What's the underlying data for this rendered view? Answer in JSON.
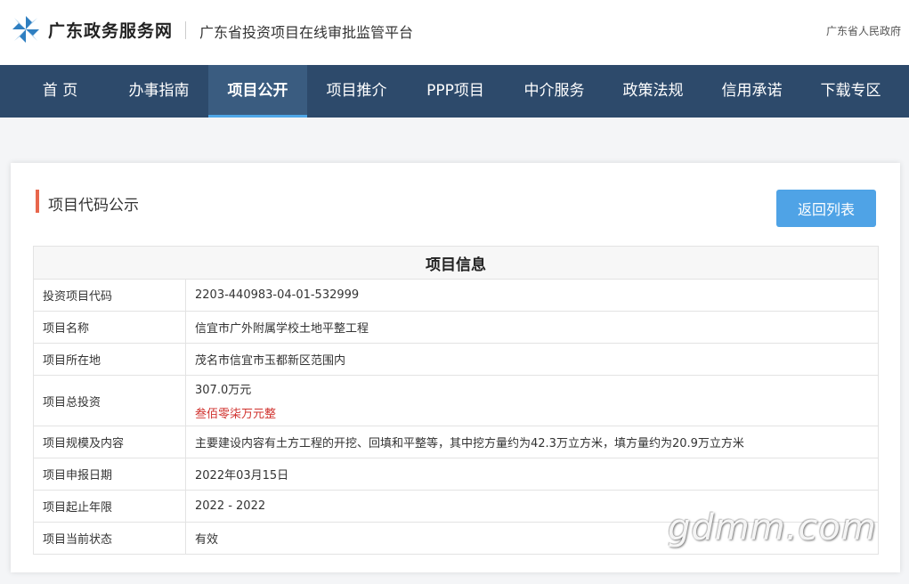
{
  "header": {
    "brand": "广东政务服务网",
    "subtitle": "广东省投资项目在线审批监管平台",
    "gov_label": "广东省人民政府",
    "logo_color": "#2f7fc1"
  },
  "nav": {
    "items": [
      {
        "label": "首 页"
      },
      {
        "label": "办事指南"
      },
      {
        "label": "项目公开"
      },
      {
        "label": "项目推介"
      },
      {
        "label": "PPP项目"
      },
      {
        "label": "中介服务"
      },
      {
        "label": "政策法规"
      },
      {
        "label": "信用承诺"
      },
      {
        "label": "下载专区"
      }
    ],
    "active": "项目公开",
    "bg_color": "#2d4a6b",
    "active_underline_color": "#4ea7e8"
  },
  "main": {
    "section_title": "项目代码公示",
    "back_button": "返回列表",
    "table": {
      "header": "项目信息",
      "rows": [
        {
          "key": "投资项目代码",
          "value": "2203-440983-04-01-532999"
        },
        {
          "key": "项目名称",
          "value": "信宜市广外附属学校土地平整工程"
        },
        {
          "key": "项目所在地",
          "value": "茂名市信宜市玉都新区范围内"
        },
        {
          "key": "项目总投资",
          "value": "307.0万元",
          "value_cn": "叁佰零柒万元整"
        },
        {
          "key": "项目规模及内容",
          "value": "主要建设内容有土方工程的开挖、回填和平整等，其中挖方量约为42.3万立方米，填方量约为20.9万立方米"
        },
        {
          "key": "项目申报日期",
          "value": "2022年03月15日"
        },
        {
          "key": "项目起止年限",
          "value": "2022 - 2022"
        },
        {
          "key": "项目当前状态",
          "value": "有效"
        }
      ]
    }
  },
  "watermark": "gdmm.com"
}
